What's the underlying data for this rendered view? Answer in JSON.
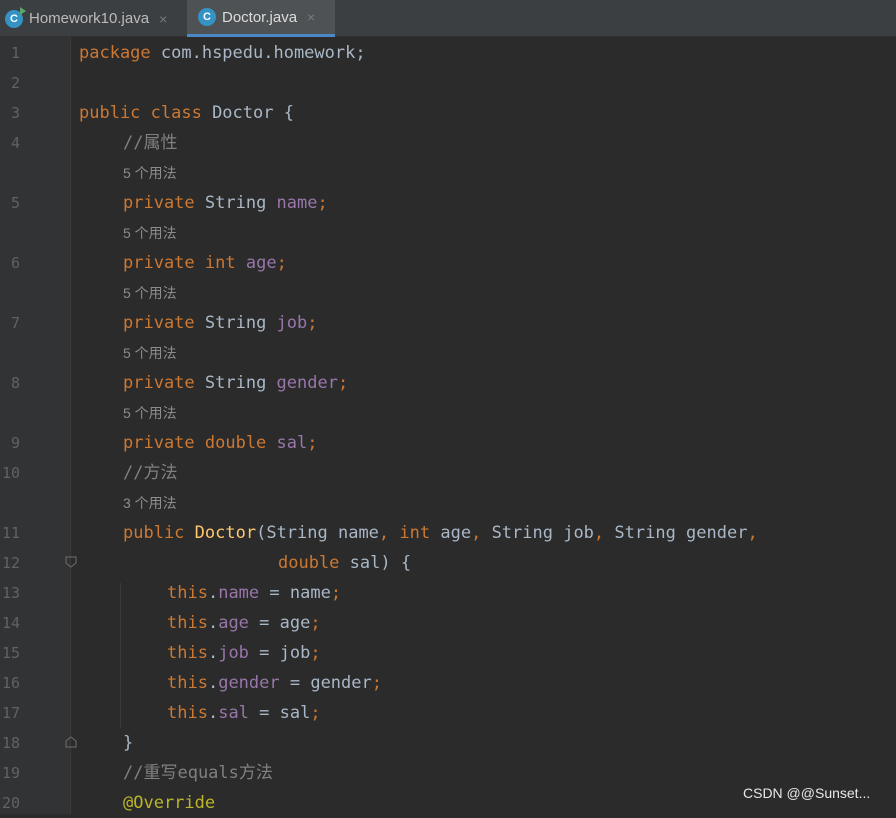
{
  "tabs": [
    {
      "label": "Homework10.java",
      "icon": "java-class-run-icon",
      "close": "×"
    },
    {
      "label": "Doctor.java",
      "icon": "java-class-icon",
      "close": "×",
      "active": true
    }
  ],
  "editor": {
    "colors": {
      "background": "#2b2b2b",
      "keyword": "#cc7832",
      "field": "#9876aa",
      "method": "#ffc66d",
      "comment": "#808080",
      "annotation": "#bbb529",
      "text": "#a9b7c6"
    },
    "line_numbers": [
      "1",
      "2",
      "3",
      "4",
      "5",
      "6",
      "7",
      "8",
      "9",
      "10",
      "11",
      "12",
      "13",
      "14",
      "15",
      "16",
      "17",
      "18",
      "19",
      "20"
    ],
    "usages": {
      "name": "5 个用法",
      "age": "5 个用法",
      "job": "5 个用法",
      "gender": "5 个用法",
      "sal": "5 个用法",
      "ctor": "3 个用法"
    },
    "code": {
      "l1_kw": "package",
      "l1_rest": " com.hspedu.homework;",
      "l3_kw": "public class",
      "l3_rest": " Doctor {",
      "l4_cm": "//属性",
      "l5_kw": "private",
      "l5_type": " String ",
      "l5_field": "name",
      "l5_end": ";",
      "l6_kw": "private int",
      "l6_sp": " ",
      "l6_field": "age",
      "l6_end": ";",
      "l7_kw": "private",
      "l7_type": " String ",
      "l7_field": "job",
      "l7_end": ";",
      "l8_kw": "private",
      "l8_type": " String ",
      "l8_field": "gender",
      "l8_end": ";",
      "l9_kw": "private double",
      "l9_sp": " ",
      "l9_field": "sal",
      "l9_end": ";",
      "l10_cm": "//方法",
      "l11_kw": "public",
      "l11_sp": " ",
      "l11_fn": "Doctor",
      "l11_a": "(String name",
      "l11_c1": ",",
      "l11_kw2": " int",
      "l11_b": " age",
      "l11_c2": ",",
      "l11_c": " String job",
      "l11_c3": ",",
      "l11_d": " String gender",
      "l11_c4": ",",
      "l12_kw": "double",
      "l12_rest": " sal) {",
      "l13_kw": "this",
      "l13_dot": ".",
      "l13_field": "name",
      "l13_rest": " = name",
      "l13_end": ";",
      "l14_kw": "this",
      "l14_dot": ".",
      "l14_field": "age",
      "l14_rest": " = age",
      "l14_end": ";",
      "l15_kw": "this",
      "l15_dot": ".",
      "l15_field": "job",
      "l15_rest": " = job",
      "l15_end": ";",
      "l16_kw": "this",
      "l16_dot": ".",
      "l16_field": "gender",
      "l16_rest": " = gender",
      "l16_end": ";",
      "l17_kw": "this",
      "l17_dot": ".",
      "l17_field": "sal",
      "l17_rest": " = sal",
      "l17_end": ";",
      "l18": "}",
      "l19_cm": "//重写equals方法",
      "l20_ann": "@Override"
    }
  },
  "watermark": "CSDN @@Sunset..."
}
